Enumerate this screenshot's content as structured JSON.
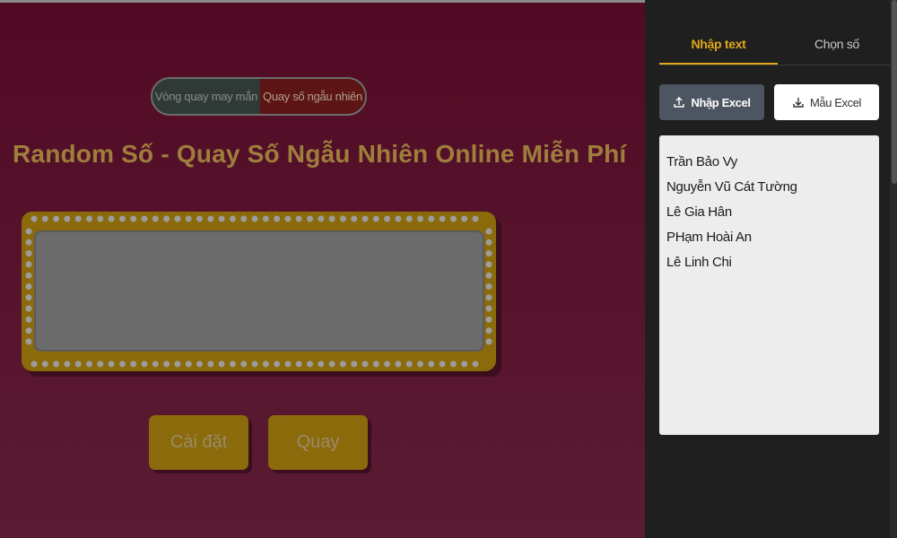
{
  "main": {
    "mode_switch": {
      "left_label": "Vòng quay may mắn",
      "right_label": "Quay số ngẫu nhiên"
    },
    "title": "Random Số - Quay Số Ngẫu Nhiên Online Miễn Phí",
    "buttons": {
      "settings_label": "Cài đặt",
      "spin_label": "Quay"
    }
  },
  "panel": {
    "tabs": [
      {
        "label": "Nhập text"
      },
      {
        "label": "Chọn số"
      }
    ],
    "import_label": "Nhập Excel",
    "template_label": "Mẫu Excel",
    "names": [
      "Trần Bảo Vy",
      "Nguyễn Vũ Cát Tường",
      "Lê Gia Hân",
      "PHạm Hoài An",
      "Lê Linh Chi"
    ]
  },
  "colors": {
    "background": "#520a24",
    "accent_gold": "#8a6a0a",
    "tab_active": "#e0a818",
    "panel_bg": "#1f1f1f"
  },
  "icons": {
    "import": "upload-icon",
    "template": "download-icon"
  }
}
